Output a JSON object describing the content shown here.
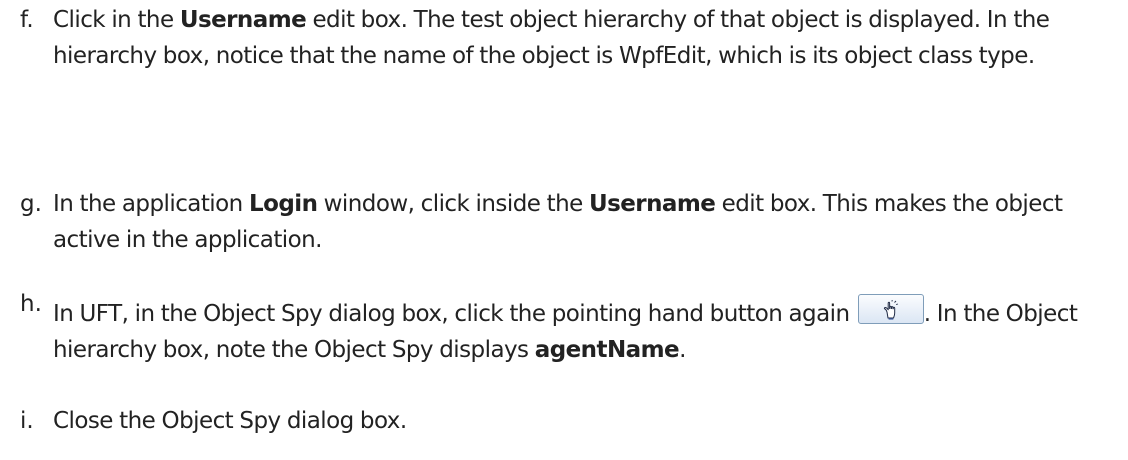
{
  "steps": [
    {
      "letter": "f.",
      "parts": [
        "Click in the ",
        "Username",
        " edit box. The test object hierarchy of that object is displayed. In the hierarchy box, notice that the name of the object is WpfEdit, which is its object class type."
      ]
    },
    {
      "letter": "g.",
      "parts": [
        "In the application ",
        "Login",
        " window, click inside the ",
        "Username",
        " edit box. This makes the object active in the application."
      ]
    },
    {
      "letter": "h.",
      "parts": [
        "In UFT, in the Object Spy dialog box, click the pointing hand button again ",
        ". In the Object hierarchy box, note the Object Spy displays ",
        "agentName",
        "."
      ]
    },
    {
      "letter": "i.",
      "parts": [
        "Close the Object Spy dialog box."
      ]
    }
  ],
  "icons": {
    "pointing_hand": "pointing-hand-icon"
  }
}
